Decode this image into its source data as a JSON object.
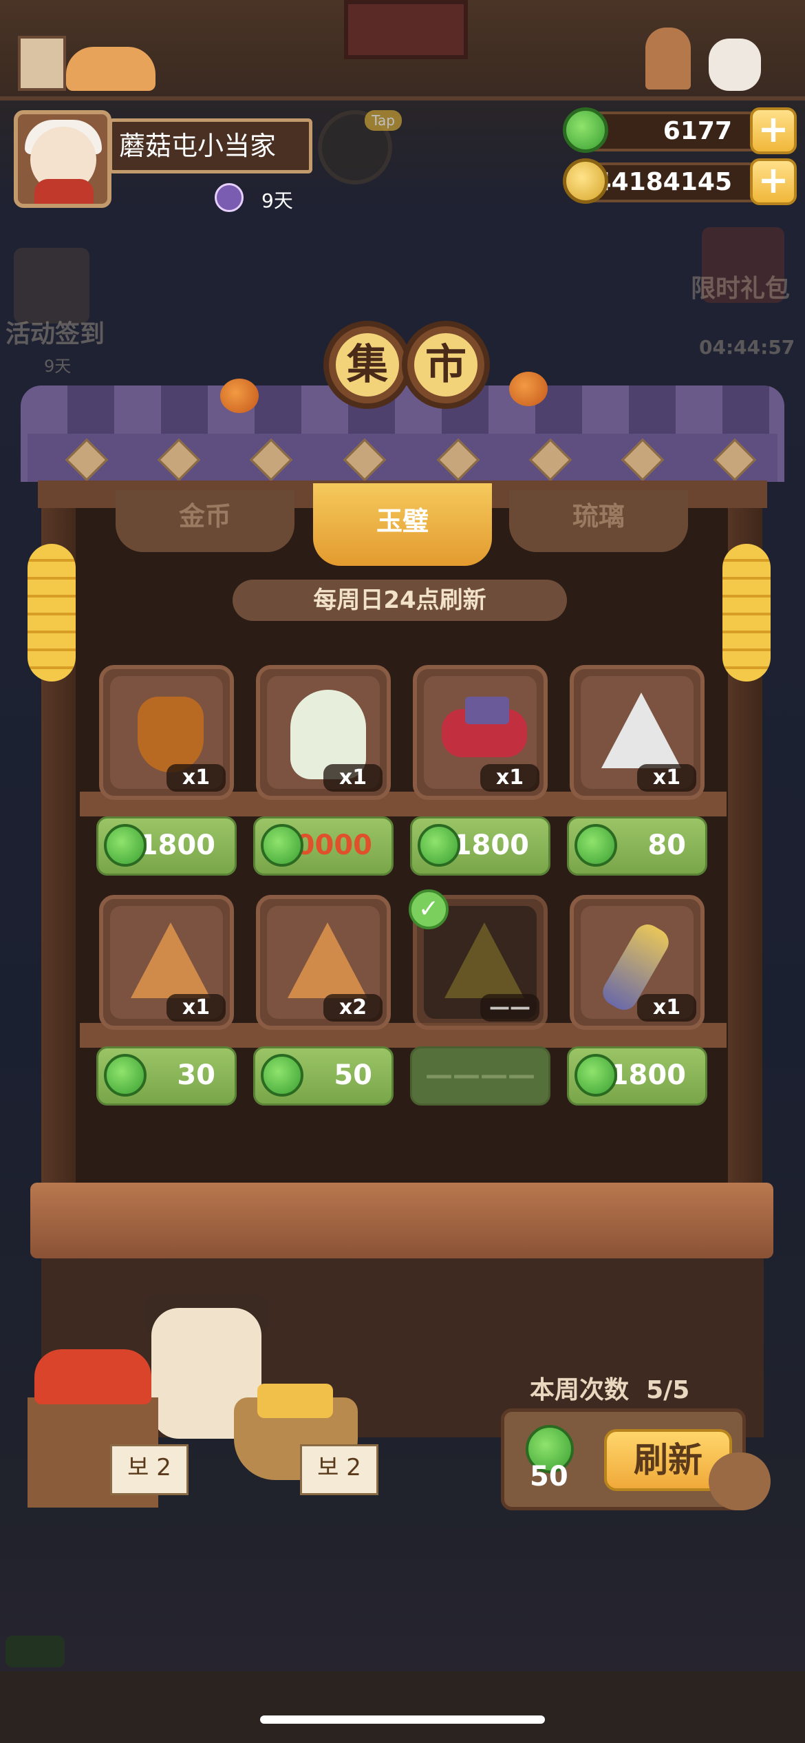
{
  "header": {
    "player_name": "蘑菇屯小当家",
    "days": "9天",
    "tap_label": "Tap"
  },
  "currency": {
    "jade": "6177",
    "gold": "44184145",
    "plus": "+"
  },
  "side": {
    "checkin_label": "活动签到",
    "checkin_days": "9天",
    "gift_label": "限时礼包",
    "gift_timer": "04:44:57"
  },
  "market": {
    "title_1": "集",
    "title_2": "市",
    "tabs": [
      "金币",
      "玉璧",
      "琉璃"
    ],
    "active_tab": "玉璧",
    "refresh_note": "每周日24点刷新",
    "items": [
      {
        "icon": "pastry-jar-icon",
        "qty": "x1",
        "price": "1800",
        "sold": false
      },
      {
        "icon": "green-hood-doll-icon",
        "qty": "x1",
        "price": "30000",
        "sold": false
      },
      {
        "icon": "red-ink-stamp-icon",
        "qty": "x1",
        "price": "1800",
        "sold": false
      },
      {
        "icon": "white-swirl-stone-icon",
        "qty": "x1",
        "price": "80",
        "sold": false
      },
      {
        "icon": "wheel-rune-stone-icon",
        "qty": "x1",
        "price": "30",
        "sold": false
      },
      {
        "icon": "eye-rune-stone-icon",
        "qty": "x2",
        "price": "50",
        "sold": false
      },
      {
        "icon": "gold-rune-stone-icon",
        "qty": "——",
        "price": "————",
        "sold": true
      },
      {
        "icon": "feather-brush-icon",
        "qty": "x1",
        "price": "1800",
        "sold": false
      }
    ]
  },
  "weekly": {
    "label": "本周次数",
    "count": "5/5",
    "refresh_cost": "50",
    "refresh_button": "刷新"
  },
  "stall_signs": {
    "left": "보 2",
    "right": "보 2"
  },
  "colors": {
    "price_green": "#8ab95a",
    "expensive_red": "#e0502a",
    "tab_active": "#f0b74a"
  }
}
